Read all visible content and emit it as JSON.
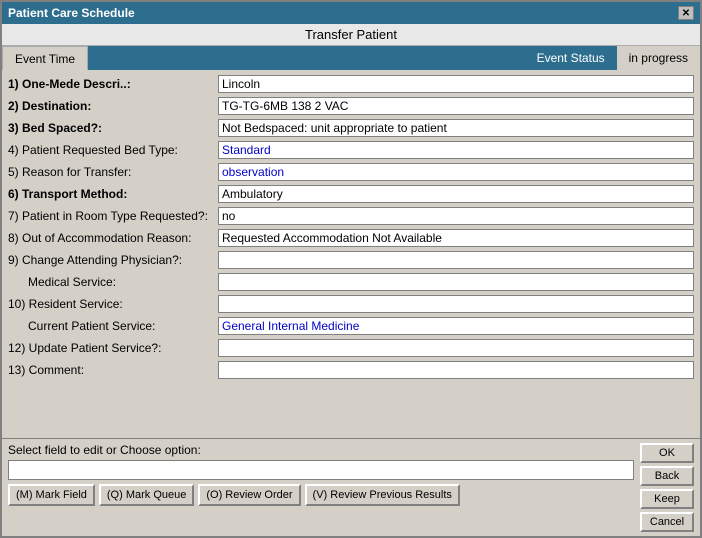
{
  "window": {
    "title": "Patient Care Schedule",
    "close_label": "✕"
  },
  "transfer_header": "Transfer Patient",
  "tabs": [
    {
      "label": "Event Time",
      "active": true
    },
    {
      "label": "Event Status",
      "active": false
    }
  ],
  "event_status": {
    "label": "Event Status",
    "value": "in progress"
  },
  "form_rows": [
    {
      "number": "1)",
      "label": "One-Mede Descri..:",
      "label_bold": true,
      "value": "Lincoln",
      "indented": false,
      "colored": false
    },
    {
      "number": "2)",
      "label": "Destination:",
      "label_bold": true,
      "value": "TG-TG-6MB 138 2 VAC",
      "indented": false,
      "colored": false
    },
    {
      "number": "3)",
      "label": "Bed Spaced?:",
      "label_bold": true,
      "value": "Not Bedspaced: unit appropriate to patient",
      "indented": false,
      "colored": false
    },
    {
      "number": "4)",
      "label": "Patient Requested Bed Type:",
      "label_bold": false,
      "value": "Standard",
      "indented": false,
      "colored": true
    },
    {
      "number": "5)",
      "label": "Reason for Transfer:",
      "label_bold": false,
      "value": "observation",
      "indented": false,
      "colored": true
    },
    {
      "number": "6)",
      "label": "Transport Method:",
      "label_bold": true,
      "value": "Ambulatory",
      "indented": false,
      "colored": false
    },
    {
      "number": "7)",
      "label": "Patient in Room Type Requested?:",
      "label_bold": false,
      "value": "no",
      "indented": false,
      "colored": false
    },
    {
      "number": "8)",
      "label": "Out of Accommodation Reason:",
      "label_bold": false,
      "value": "Requested Accommodation Not Available",
      "indented": false,
      "colored": false,
      "orange_word": "Requested"
    },
    {
      "number": "9)",
      "label": "Change Attending Physician?:",
      "label_bold": false,
      "value": "",
      "indented": false,
      "colored": false
    },
    {
      "number": "",
      "label": "Medical Service:",
      "label_bold": false,
      "value": "",
      "indented": true,
      "colored": false
    },
    {
      "number": "10)",
      "label": "Resident Service:",
      "label_bold": false,
      "value": "",
      "indented": false,
      "colored": false
    },
    {
      "number": "",
      "label": "Current Patient Service:",
      "label_bold": false,
      "value": "General Internal Medicine",
      "indented": true,
      "colored": true
    },
    {
      "number": "12)",
      "label": "Update Patient Service?:",
      "label_bold": false,
      "value": "",
      "indented": false,
      "colored": false
    },
    {
      "number": "13)",
      "label": "Comment:",
      "label_bold": false,
      "value": "",
      "indented": false,
      "colored": false
    }
  ],
  "bottom": {
    "select_label": "Select field to edit or Choose option:",
    "input_value": "",
    "buttons": {
      "ok": "OK",
      "back": "Back",
      "keep": "Keep",
      "cancel": "Cancel"
    },
    "action_buttons": [
      {
        "label": "(M) Mark Field",
        "key": "M"
      },
      {
        "label": "(Q) Mark Queue",
        "key": "Q"
      },
      {
        "label": "(O) Review Order",
        "key": "O"
      },
      {
        "label": "(V) Review Previous Results",
        "key": "V"
      }
    ]
  }
}
